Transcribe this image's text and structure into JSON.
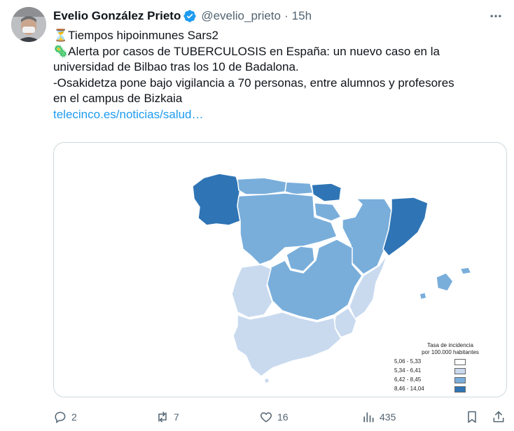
{
  "author": {
    "display_name": "Evelio González Prieto",
    "handle": "@evelio_prieto",
    "separator": "·",
    "time": "15h",
    "verified": true
  },
  "tweet": {
    "lines": [
      "⏳Tiempos hipoinmunes Sars2",
      "🦠Alerta por casos de TUBERCULOSIS en España: un nuevo caso en la",
      "universidad de Bilbao tras los 10 de Badalona.",
      "-Osakidetza pone bajo vigilancia a 70 personas, entre alumnos y profesores",
      "en el campus de Bizkaia"
    ],
    "link": "telecinco.es/noticias/salud…"
  },
  "map": {
    "legend_title_1": "Tasa de incidencia",
    "legend_title_2": "por 100.000 habitantes",
    "legend": [
      {
        "label": "5,06 - 5,33",
        "color": "#ffffff"
      },
      {
        "label": "5,34 - 6,41",
        "color": "#c9daef"
      },
      {
        "label": "6,42 - 8,45",
        "color": "#79aedb"
      },
      {
        "label": "8,46 - 14,04",
        "color": "#2f75b5"
      }
    ],
    "colors": {
      "lightest": "#ffffff",
      "light": "#c9daef",
      "medium": "#79aedb",
      "dark": "#2f75b5",
      "border": "#ffffff"
    }
  },
  "actions": {
    "reply_count": "2",
    "retweet_count": "7",
    "like_count": "16",
    "views_count": "435"
  },
  "colors": {
    "accent": "#1d9bf0",
    "text": "#0f1419",
    "muted": "#536471"
  }
}
